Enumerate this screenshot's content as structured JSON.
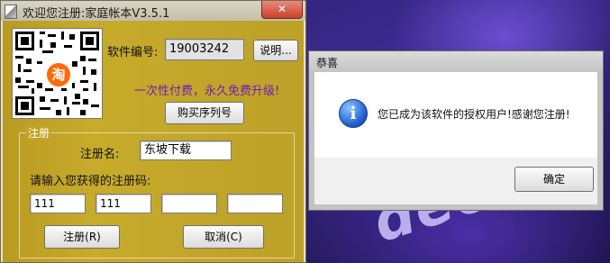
{
  "main_window": {
    "title": "欢迎您注册:家庭帐本V3.5.1",
    "close_glyph": "✕",
    "qr_badge": "淘",
    "software_id_label": "软件编号:",
    "software_id_value": "19003242",
    "help_button": "说明...",
    "promo_text": "一次性付费，永久免费升级!",
    "buy_button": "购买序列号",
    "group_title": "注册",
    "reg_name_label": "注册名:",
    "reg_name_value": "东坡下载",
    "reg_code_label": "请输入您获得的注册码:",
    "reg_codes": [
      "111",
      "111",
      "",
      ""
    ],
    "register_button": "注册(R)",
    "cancel_button": "取消(C)"
  },
  "dialog": {
    "title": "恭喜",
    "message": "您已成为该软件的授权用户!感谢您注册!",
    "ok_button": "确定",
    "icon": "info-icon"
  },
  "desktop": {
    "watermark_text": "deoV."
  },
  "colors": {
    "main_body": "#c1a428",
    "promo_text": "#6a1fb5",
    "close_button": "#c8412b",
    "info_icon": "#1f5fcf",
    "taobao_badge": "#ff6a0a"
  }
}
